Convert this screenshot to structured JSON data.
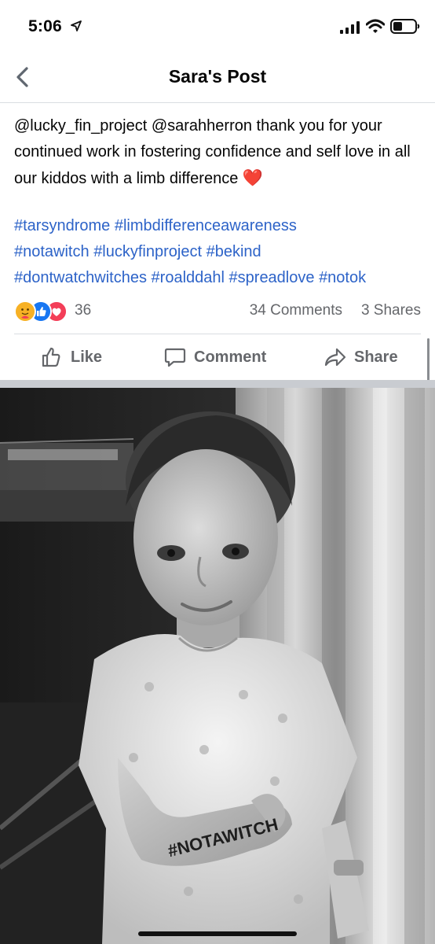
{
  "status_bar": {
    "time": "5:06",
    "icons": [
      "location-arrow-icon",
      "cellular-signal-icon",
      "wifi-icon",
      "battery-icon"
    ]
  },
  "nav": {
    "title": "Sara's Post",
    "back_icon": "chevron-left-icon"
  },
  "post": {
    "text": "@lucky_fin_project @sarahherron thank you for your continued work in fostering confidence and self love in all our kiddos with a limb difference",
    "emoji": "❤️",
    "hashtags": [
      "#tarsyndrome",
      "#limbdifferenceawareness",
      "#notawitch",
      "#luckyfinproject",
      "#bekind",
      "#dontwatchwitches",
      "#roalddahl",
      "#spreadlove",
      "#notok"
    ]
  },
  "reactions": {
    "icons": [
      "care-reaction-icon",
      "like-reaction-icon",
      "love-reaction-icon"
    ],
    "count": "36",
    "comments": "34 Comments",
    "shares": "3 Shares"
  },
  "actions": {
    "like": "Like",
    "comment": "Comment",
    "share": "Share"
  },
  "photo": {
    "hand_text": "#NOTAWITCH"
  },
  "colors": {
    "link": "#2d63c8",
    "muted": "#65676b",
    "like_blue": "#1877f2",
    "love_red": "#f33e58",
    "care_yellow": "#f7b125"
  }
}
